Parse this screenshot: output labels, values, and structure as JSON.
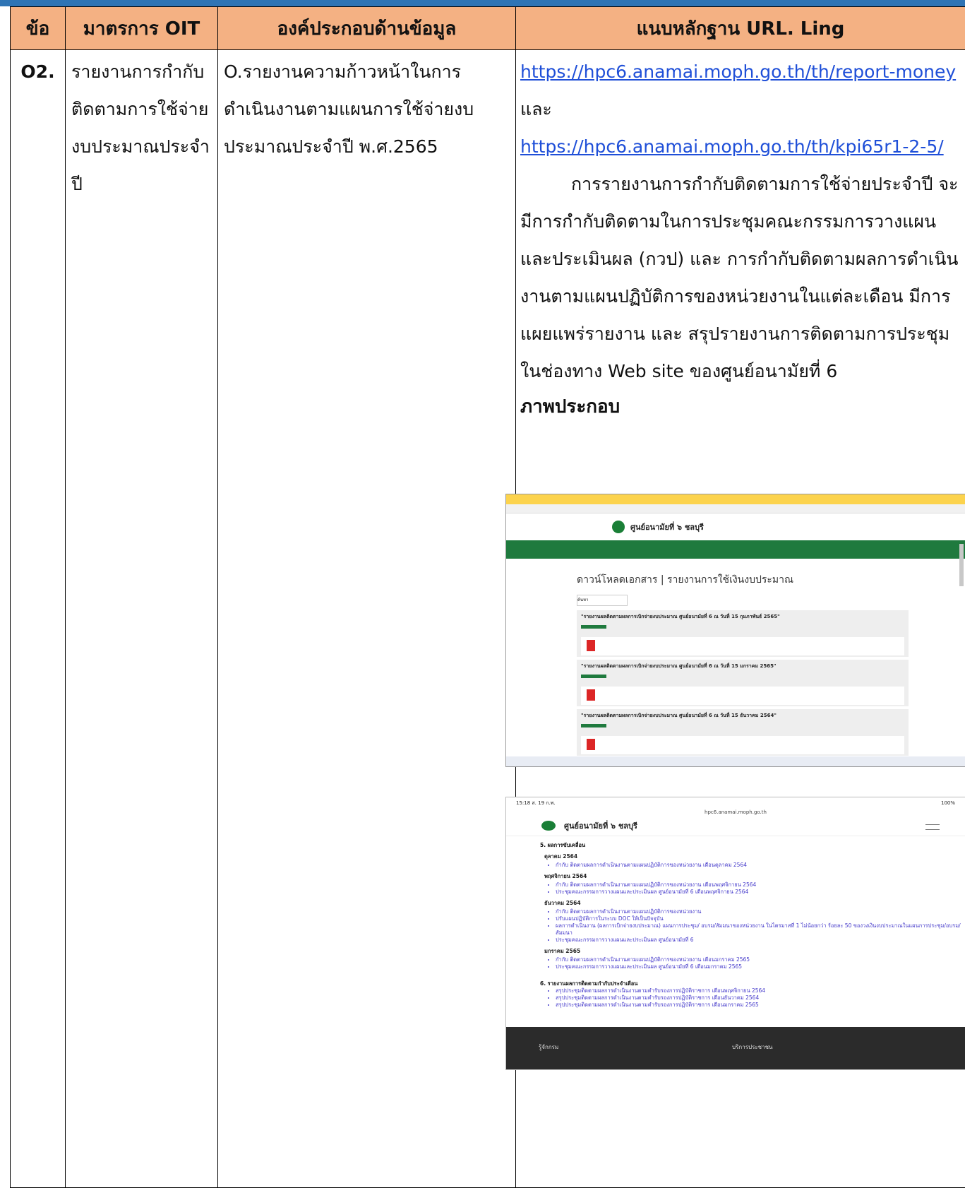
{
  "table": {
    "headers": [
      "ข้อ",
      "มาตรการ OIT",
      "องค์ประกอบด้านข้อมูล",
      "แนบหลักฐาน URL. Ling"
    ],
    "row": {
      "no": "O2.",
      "measure": "รายงานการกำกับติดตามการใช้จ่ายงบประมาณประจำปี",
      "component": "O.รายงานความก้าวหน้าในการดำเนินงานตามแผนการใช้จ่ายงบประมาณประจำปี พ.ศ.2565",
      "link1": "https://hpc6.anamai.moph.go.th/th/report-money",
      "and": " และ",
      "link2": "https://hpc6.anamai.moph.go.th/th/kpi65r1-2-5/",
      "description": "การรายงานการกำกับติดตามการใช้จ่ายประจำปี จะมีการกำกับติดตามในการประชุมคณะกรรมการวางแผนและประเมินผล (กวป) และ การกำกับติดตามผลการดำเนินงานตามแผนปฏิบัติการของหน่วยงานในแต่ละเดือน มีการแผยแพร่รายงาน และ สรุปรายงานการติดตามการประชุม ในช่องทาง Web site ของศูนย์อนามัยที่ 6",
      "figure_title": "ภาพประกอบ"
    }
  },
  "screenshot1": {
    "site_name": "ศูนย์อนามัยที่ ๖ ชลบุรี",
    "heading": "ดาวน์โหลดเอกสาร | รายงานการใช้เงินงบประมาณ",
    "search_placeholder": "ค้นหา",
    "cards": [
      "\"รายงานผลติดตามผลการเบิกจ่ายงบประมาณ ศูนย์อนามัยที่ 6 ณ วันที่ 15 กุมภาพันธ์ 2565\"",
      "\"รายงานผลติดตามผลการเบิกจ่ายงบประมาณ ศูนย์อนามัยที่ 6 ณ วันที่ 15 มกราคม 2565\"",
      "\"รายงานผลติดตามผลการเบิกจ่ายงบประมาณ ศูนย์อนามัยที่ 6 ณ วันที่ 15 ธันวาคม 2564\""
    ],
    "accent": "#1f7a3e"
  },
  "screenshot2": {
    "status_time": "15:18 ส. 19 ก.พ.",
    "battery": "100%",
    "url": "hpc6.anamai.moph.go.th",
    "site_name": "ศูนย์อนามัยที่ ๖ ชลบุรี",
    "section5": "5. ผลการขับเคลื่อน",
    "months": [
      {
        "label": "ตุลาคม 2564",
        "items": [
          "กำกับ ติดตามผลการดำเนินงานตามแผนปฏิบัติการของหน่วยงาน เดือนตุลาคม 2564"
        ]
      },
      {
        "label": "พฤศจิกายน 2564",
        "items": [
          "กำกับ ติดตามผลการดำเนินงานตามแผนปฏิบัติการของหน่วยงาน เดือนพฤศจิกายน 2564",
          "ประชุมคณะกรรมการวางแผนและประเมินผล ศูนย์อนามัยที่ 6 เดือนพฤศจิกายน 2564"
        ]
      },
      {
        "label": "ธันวาคม 2564",
        "items": [
          "กำกับ ติดตามผลการดำเนินงานตามแผนปฏิบัติการของหน่วยงาน",
          "ปรับแผนปฏิบัติการในระบบ DOC ให้เป็นปัจจุบัน",
          "ผลการดำเนินงาน (ผลการเบิกจ่ายงบประมาณ) แผนการประชุม/ อบรม/สัมมนาของหน่วยงาน ในไตรมาสที่ 1 ไม่น้อยกว่า ร้อยละ 50 ของวงเงินงบประมาณในแผนการประชุม/อบรม/สัมมนา",
          "ประชุมคณะกรรมการวางแผนและประเมินผล ศูนย์อนามัยที่ 6"
        ]
      },
      {
        "label": "มกราคม 2565",
        "items": [
          "กำกับ ติดตามผลการดำเนินงานตามแผนปฏิบัติการของหน่วยงาน เดือนมกราคม 2565",
          "ประชุมคณะกรรมการวางแผนและประเมินผล ศูนย์อนามัยที่ 6 เดือนมกราคม 2565"
        ]
      }
    ],
    "section6": "6. รายงานผลการติดตามกำกับประจำเดือน",
    "section6_items": [
      "สรุปประชุมติดตามผลการดำเนินงานตามคำรับรองการปฏิบัติราชการ เดือนพฤศจิกายน 2564",
      "สรุปประชุมติดตามผลการดำเนินงานตามคำรับรองการปฏิบัติราชการ เดือนธันวาคม 2564",
      "สรุปประชุมติดตามผลการดำเนินงานตามคำรับรองการปฏิบัติราชการ เดือนมกราคม 2565"
    ],
    "footer_left": "รู้จักกรม",
    "footer_right": "บริการประชาชน"
  }
}
